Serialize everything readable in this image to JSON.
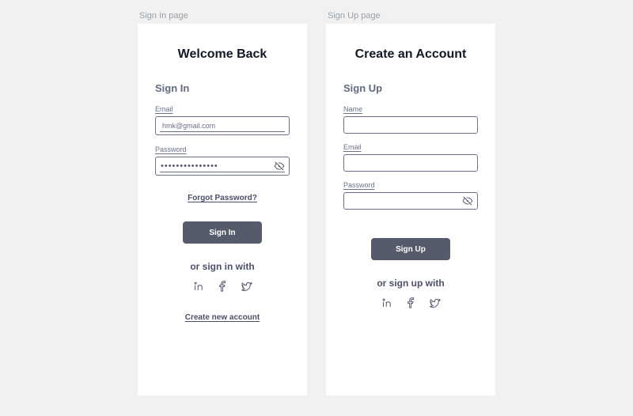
{
  "signin": {
    "page_label": "Sign In page",
    "title": "Welcome Back",
    "section": "Sign In",
    "email_label": "Email",
    "email_value": "hmk@gmail.com",
    "password_label": "Password",
    "password_masked": "•••••••••••••••",
    "forgot_link": "Forgot Password?",
    "submit": "Sign In",
    "alt_heading": "or sign in with",
    "create_link": "Create new account"
  },
  "signup": {
    "page_label": "Sign Up page",
    "title": "Create an Account",
    "section": "Sign Up",
    "name_label": "Name",
    "name_value": "",
    "email_label": "Email",
    "email_value": "",
    "password_label": "Password",
    "password_value": "",
    "submit": "Sign Up",
    "alt_heading": "or sign up with"
  },
  "icons": {
    "linkedin": "linkedin-icon",
    "facebook": "facebook-icon",
    "twitter": "twitter-icon",
    "eye_off": "eye-off-icon"
  },
  "colors": {
    "button_bg": "#565b6c",
    "text_muted": "#6b7189",
    "card_bg": "#ffffff",
    "page_bg": "#f1f1f1"
  }
}
